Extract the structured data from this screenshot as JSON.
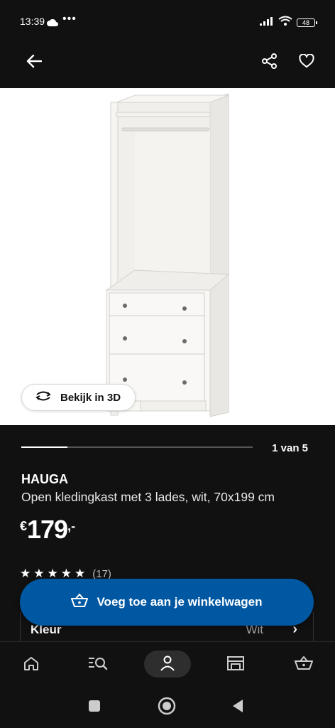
{
  "status": {
    "time": "13:39",
    "dots": "•••",
    "battery": "48"
  },
  "product": {
    "name": "HAUGA",
    "description": "Open kledingkast met 3 lades, wit, 70x199 cm",
    "price_currency": "€",
    "price_main": "179",
    "price_decimal": ",-",
    "rating_stars": 5,
    "review_count": "(17)"
  },
  "gallery": {
    "view3d_label": "Bekijk in 3D",
    "page_indicator": "1 van 5",
    "progress": 0.2
  },
  "attributes": {
    "color_label": "Kleur",
    "color_value": "Wit"
  },
  "cta": {
    "add_to_cart": "Voeg toe aan je winkelwagen"
  },
  "colors": {
    "accent": "#0058a3",
    "background": "#111111"
  },
  "nav": {
    "items": [
      {
        "icon": "home-icon"
      },
      {
        "icon": "search-icon"
      },
      {
        "icon": "profile-icon"
      },
      {
        "icon": "store-icon"
      },
      {
        "icon": "cart-icon"
      }
    ]
  }
}
